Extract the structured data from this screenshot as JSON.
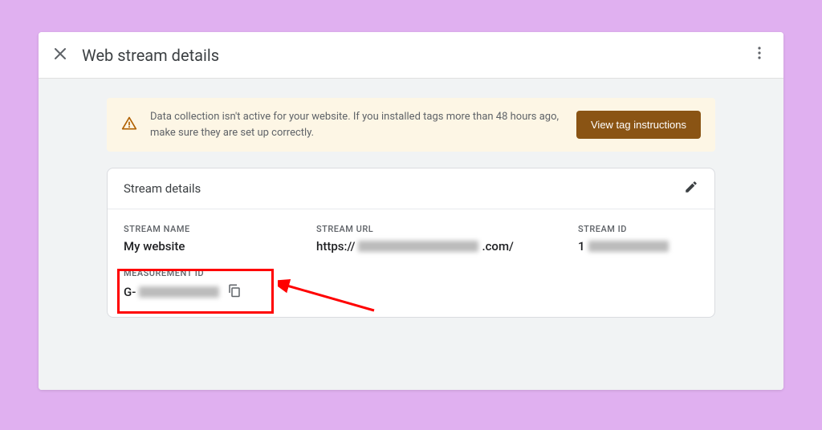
{
  "header": {
    "title": "Web stream details"
  },
  "alert": {
    "text": "Data collection isn't active for your website. If you installed tags more than 48 hours ago, make sure they are set up correctly.",
    "button": "View tag instructions"
  },
  "card": {
    "title": "Stream details",
    "labels": {
      "stream_name": "STREAM NAME",
      "stream_url": "STREAM URL",
      "stream_id": "STREAM ID",
      "measurement_id": "MEASUREMENT ID"
    },
    "values": {
      "stream_name": "My website",
      "stream_url_prefix": "https://",
      "stream_url_suffix": ".com/",
      "stream_id_prefix": "1",
      "measurement_id_prefix": "G-"
    }
  }
}
